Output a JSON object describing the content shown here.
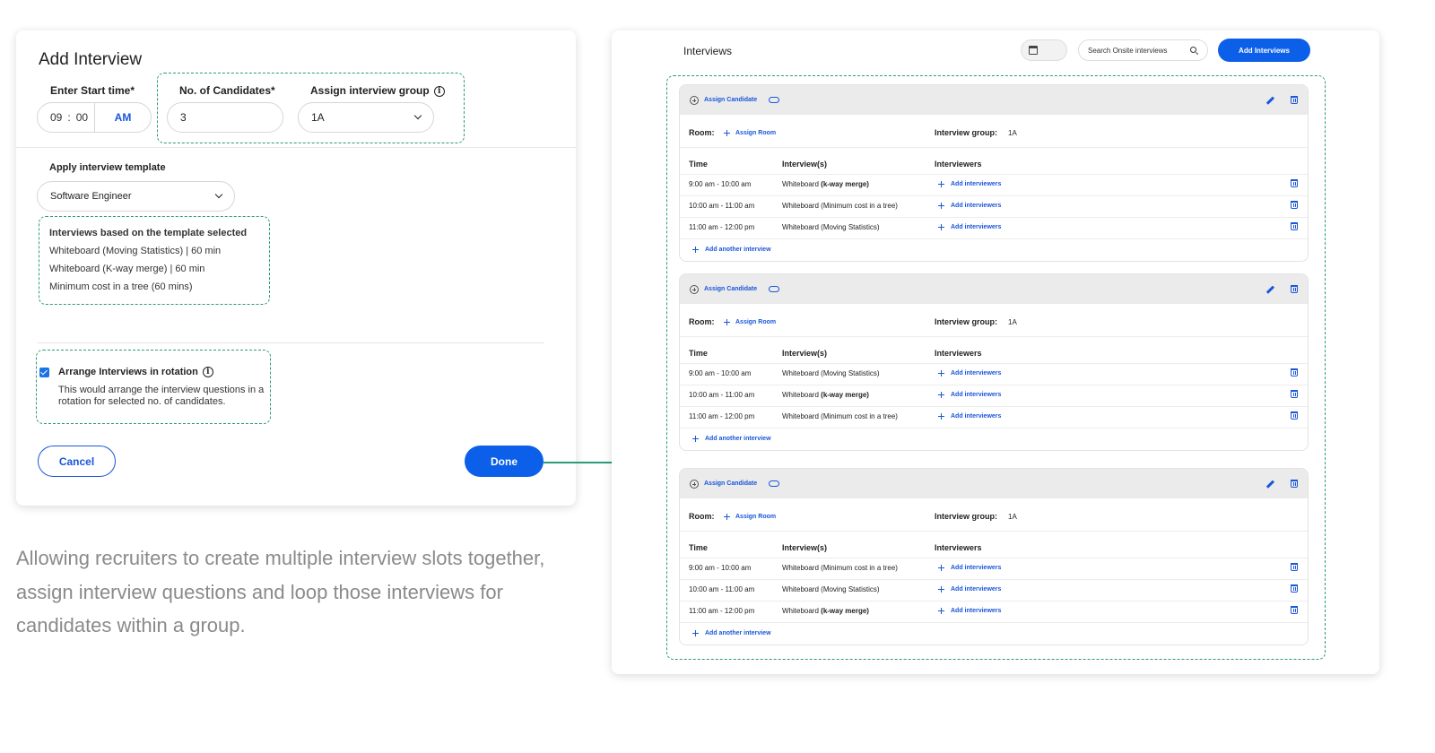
{
  "add_interview": {
    "title": "Add Interview",
    "start_time_label": "Enter Start time*",
    "hour": "09",
    "colon": ":",
    "minute": "00",
    "ampm": "AM",
    "candidates_label": "No. of Candidates*",
    "candidates_value": "3",
    "group_label": "Assign interview group",
    "group_value": "1A",
    "template_label": "Apply interview template",
    "template_value": "Software Engineer",
    "template_box_title": "Interviews based on the template selected",
    "template_items": [
      "Whiteboard (Moving Statistics)  |  60 min",
      "Whiteboard (K-way merge)  | 60 min",
      "Minimum cost in a tree (60 mins)"
    ],
    "rotation_label": "Arrange Interviews in rotation",
    "rotation_desc": "This would arrange the interview questions in a rotation for selected no. of candidates.",
    "cancel_label": "Cancel",
    "done_label": "Done"
  },
  "caption": "Allowing recruiters to create multiple interview slots together, assign interview questions and loop those interviews for candidates within a group.",
  "interviews_panel": {
    "title": "Interviews",
    "search_placeholder": "Search Onsite interviews",
    "add_button": "Add Interviews",
    "assign_candidate": "Assign Candidate",
    "room_label": "Room:",
    "assign_room": "Assign Room",
    "group_label": "Interview group:",
    "col_time": "Time",
    "col_interviews": "Interview(s)",
    "col_interviewers": "Interviewers",
    "add_interviewers": "Add interviewers",
    "add_another": "Add another interview",
    "cards": [
      {
        "group": "1A",
        "rows": [
          {
            "time": "9:00 am - 10:00 am",
            "type": "Whiteboard",
            "topic": "(k-way merge)",
            "topic_bold": true
          },
          {
            "time": "10:00 am - 11:00 am",
            "type": "Whiteboard",
            "topic": " (Minimum cost in a tree)",
            "topic_bold": false
          },
          {
            "time": "11:00 am - 12:00 pm",
            "type": "Whiteboard",
            "topic": " (Moving Statistics)",
            "topic_bold": false
          }
        ]
      },
      {
        "group": "1A",
        "rows": [
          {
            "time": "9:00 am - 10:00 am",
            "type": "Whiteboard",
            "topic": " (Moving Statistics)",
            "topic_bold": false
          },
          {
            "time": "10:00 am - 11:00 am",
            "type": "Whiteboard",
            "topic": "(k-way merge)",
            "topic_bold": true
          },
          {
            "time": "11:00 am - 12:00 pm",
            "type": "Whiteboard",
            "topic": " (Minimum cost in a tree)",
            "topic_bold": false
          }
        ]
      },
      {
        "group": "1A",
        "rows": [
          {
            "time": "9:00 am - 10:00 am",
            "type": "Whiteboard",
            "topic": " (Minimum cost in a tree)",
            "topic_bold": false
          },
          {
            "time": "10:00 am - 11:00 am",
            "type": "Whiteboard",
            "topic": " (Moving Statistics)",
            "topic_bold": false
          },
          {
            "time": "11:00 am - 12:00 pm",
            "type": "Whiteboard",
            "topic": "(k-way merge)",
            "topic_bold": true
          }
        ]
      }
    ]
  },
  "colors": {
    "accent": "#0b5fe8",
    "annotation": "#2e9a7c"
  }
}
